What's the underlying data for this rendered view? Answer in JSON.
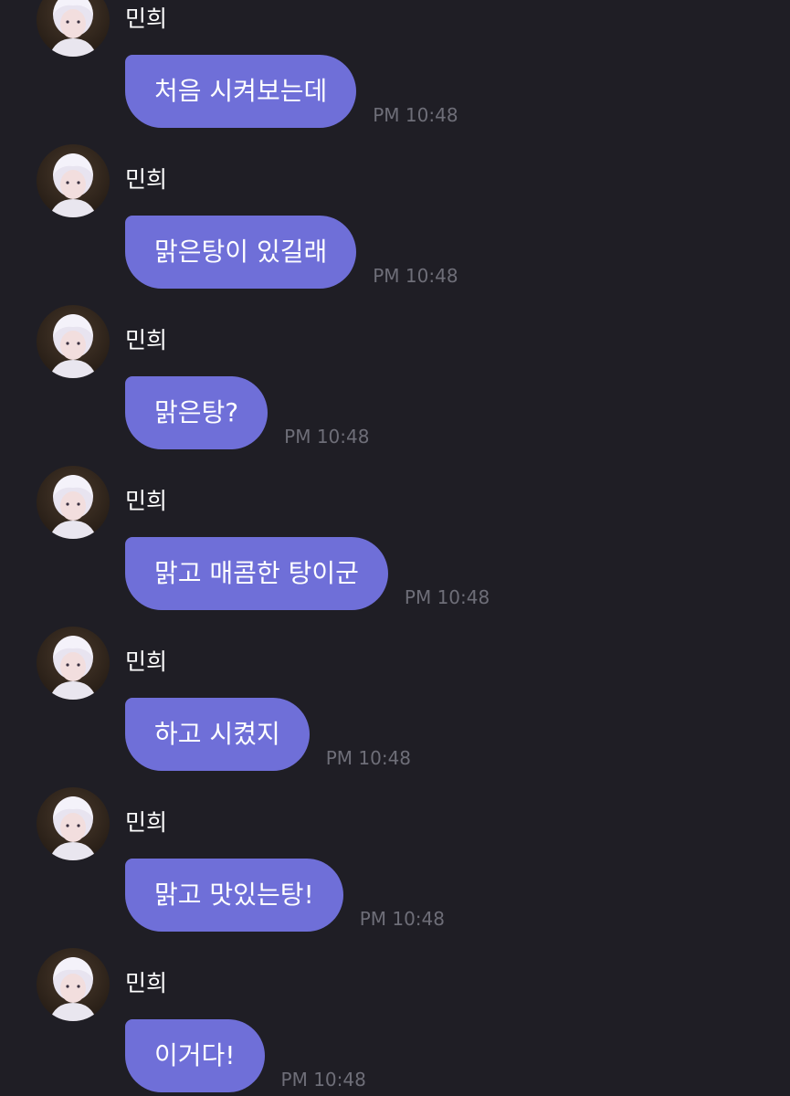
{
  "conversation": {
    "messages": [
      {
        "sender": "민희",
        "text": "처음 시켜보는데",
        "time": "PM 10:48"
      },
      {
        "sender": "민희",
        "text": "맑은탕이 있길래",
        "time": "PM 10:48"
      },
      {
        "sender": "민희",
        "text": "맑은탕?",
        "time": "PM 10:48"
      },
      {
        "sender": "민희",
        "text": "맑고 매콤한 탕이군",
        "time": "PM 10:48"
      },
      {
        "sender": "민희",
        "text": "하고 시켰지",
        "time": "PM 10:48"
      },
      {
        "sender": "민희",
        "text": "맑고 맛있는탕!",
        "time": "PM 10:48"
      },
      {
        "sender": "민희",
        "text": "이거다!",
        "time": "PM 10:48"
      }
    ]
  },
  "colors": {
    "background": "#1f1e25",
    "bubble": "#6f6fd8",
    "bubble_text": "#ffffff",
    "sender_text": "#ffffff",
    "timestamp": "#6e6e78"
  },
  "icons": {
    "avatar": "profile-photo"
  }
}
